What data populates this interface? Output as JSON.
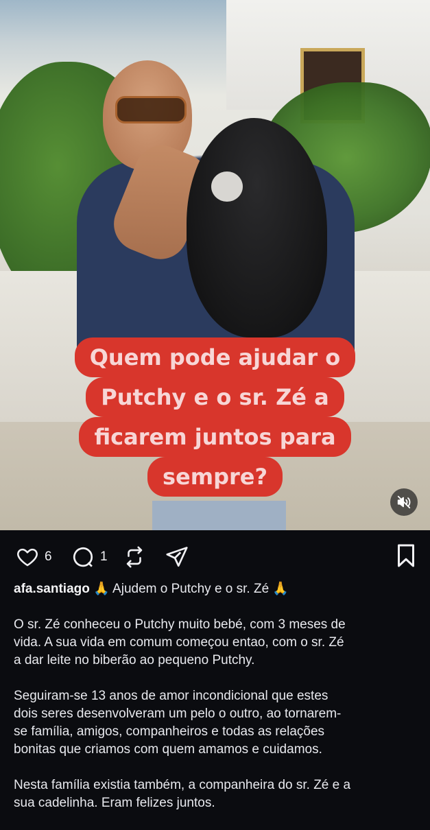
{
  "post": {
    "image_caption_lines": [
      "Quem pode ajudar o",
      "Putchy e o sr. Zé a",
      "ficarem juntos para",
      "sempre?"
    ],
    "likes_count": "6",
    "comments_count": "1",
    "username": "afa.santiago",
    "headline": "🙏 Ajudem o Putchy e o sr. Zé 🙏",
    "paragraphs": [
      "O sr. Zé conheceu o Putchy muito bebé, com 3 meses de\nvida. A sua vida em comum começou entao, com o sr. Zé\na dar leite no biberão ao pequeno Putchy.",
      "Seguiram-se 13 anos de amor incondicional que estes\ndois seres desenvolveram um pelo o outro, ao tornarem-\nse família, amigos, companheiros e todas as relações\nbonitas que criamos com quem amamos e cuidamos.",
      "Nesta família existia também, a companheira do sr. Zé e a\nsua cadelinha. Eram felizes juntos."
    ]
  },
  "icons": {
    "like": "heart-icon",
    "comment": "comment-icon",
    "repost": "repost-icon",
    "share": "send-icon",
    "save": "bookmark-icon",
    "mute": "speaker-muted-icon"
  },
  "colors": {
    "background": "#0b0c10",
    "caption_bg": "#d8362c",
    "caption_text": "#f7d6d6"
  }
}
